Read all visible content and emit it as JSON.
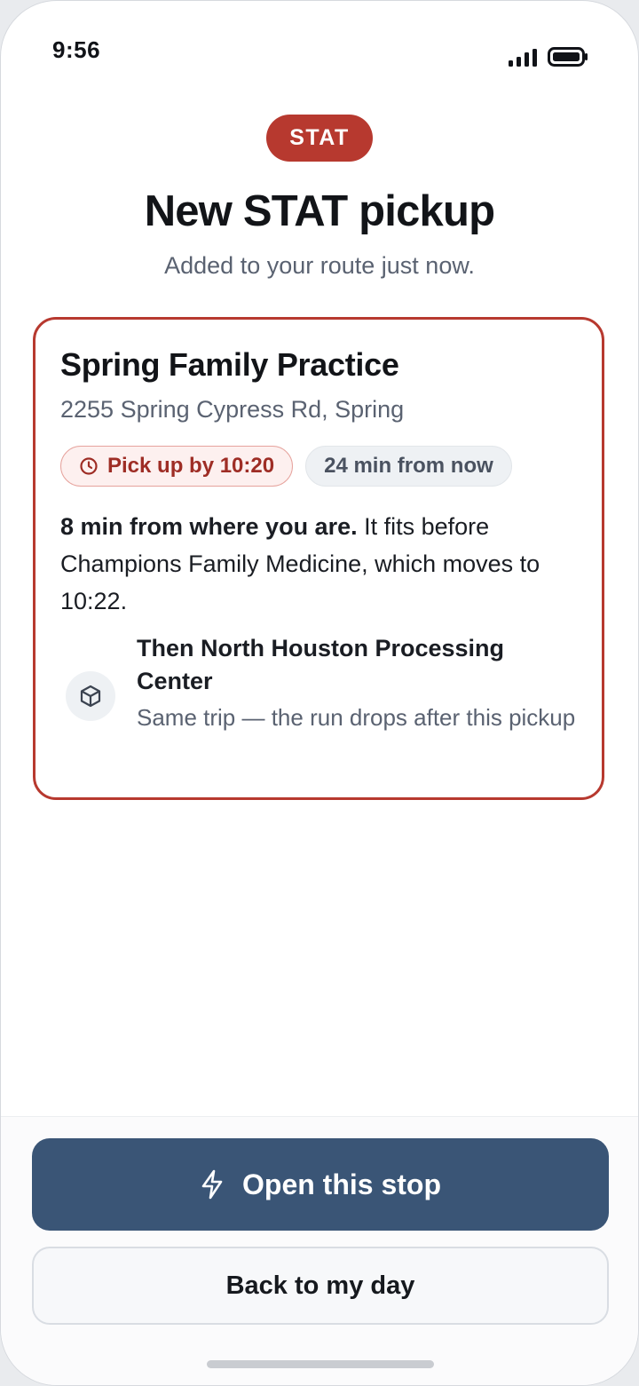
{
  "status_bar": {
    "time": "9:56"
  },
  "header": {
    "badge": "STAT",
    "title": "New STAT pickup",
    "subtitle": "Added to your route just now."
  },
  "stop": {
    "name": "Spring Family Practice",
    "address": "2255 Spring Cypress Rd, Spring",
    "deadline_chip": "Pick up by 10:20",
    "eta_chip": "24 min from now",
    "fit_lead": "8 min from where you are.",
    "fit_rest": " It fits before Champions Family Medicine, which moves to 10:22.",
    "next_title": "Then North Houston Processing Center",
    "next_desc": "Same trip — the run drops after this pickup"
  },
  "actions": {
    "primary": "Open this stop",
    "secondary": "Back to my day"
  },
  "colors": {
    "stat_red": "#b7392f",
    "primary_button": "#3a5576"
  },
  "icons": {
    "deadline": "clock-icon",
    "next": "package-icon",
    "primary": "lightning-icon"
  }
}
